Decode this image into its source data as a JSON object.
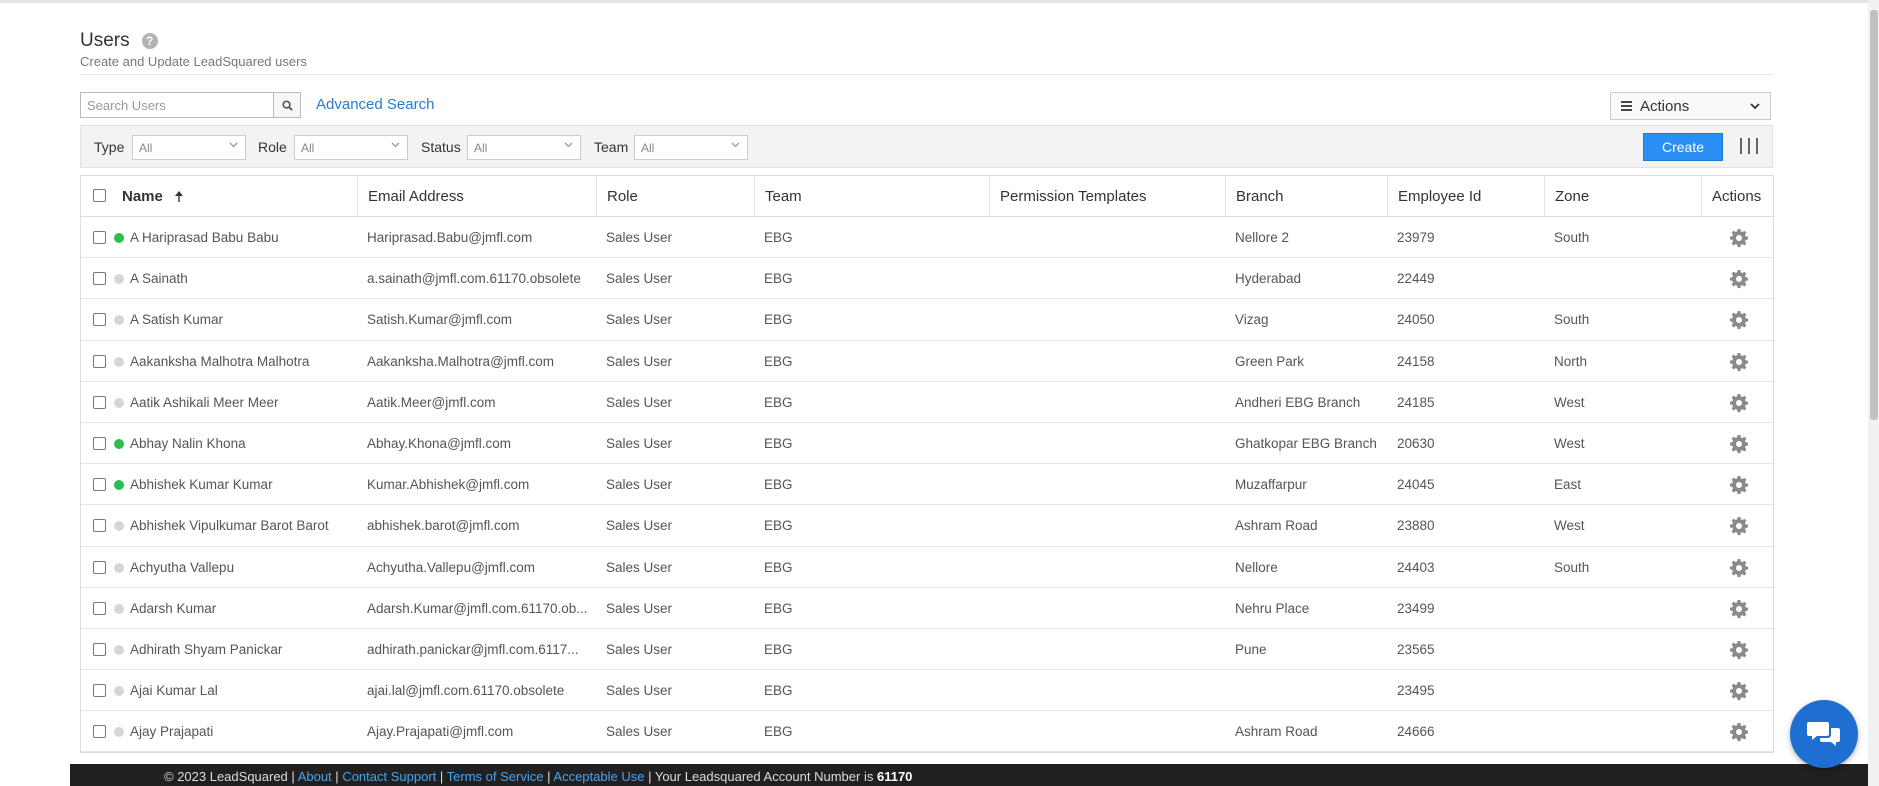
{
  "page": {
    "title": "Users",
    "subtitle": "Create and Update LeadSquared users"
  },
  "search": {
    "placeholder": "Search Users",
    "value": "",
    "advanced_label": "Advanced Search"
  },
  "actions_menu": {
    "label": "Actions"
  },
  "filters": [
    {
      "label": "Type",
      "value": "All"
    },
    {
      "label": "Role",
      "value": "All"
    },
    {
      "label": "Status",
      "value": "All"
    },
    {
      "label": "Team",
      "value": "All"
    }
  ],
  "create_label": "Create",
  "columns": [
    "Name",
    "Email Address",
    "Role",
    "Team",
    "Permission Templates",
    "Branch",
    "Employee Id",
    "Zone",
    "Actions"
  ],
  "status_colors": {
    "online": "#2dbd4e",
    "offline": "#d6d6d6"
  },
  "rows": [
    {
      "name": "A Hariprasad Babu Babu",
      "email": "Hariprasad.Babu@jmfl.com",
      "role": "Sales User",
      "team": "EBG",
      "permission": "",
      "branch": "Nellore 2",
      "employee_id": "23979",
      "zone": "South",
      "status": "online"
    },
    {
      "name": "A Sainath",
      "email": "a.sainath@jmfl.com.61170.obsolete",
      "role": "Sales User",
      "team": "EBG",
      "permission": "",
      "branch": "Hyderabad",
      "employee_id": "22449",
      "zone": "",
      "status": "offline"
    },
    {
      "name": "A Satish Kumar",
      "email": "Satish.Kumar@jmfl.com",
      "role": "Sales User",
      "team": "EBG",
      "permission": "",
      "branch": "Vizag",
      "employee_id": "24050",
      "zone": "South",
      "status": "offline"
    },
    {
      "name": "Aakanksha Malhotra Malhotra",
      "email": "Aakanksha.Malhotra@jmfl.com",
      "role": "Sales User",
      "team": "EBG",
      "permission": "",
      "branch": "Green Park",
      "employee_id": "24158",
      "zone": "North",
      "status": "offline"
    },
    {
      "name": "Aatik Ashikali Meer Meer",
      "email": "Aatik.Meer@jmfl.com",
      "role": "Sales User",
      "team": "EBG",
      "permission": "",
      "branch": "Andheri EBG Branch",
      "employee_id": "24185",
      "zone": "West",
      "status": "offline"
    },
    {
      "name": "Abhay Nalin Khona",
      "email": "Abhay.Khona@jmfl.com",
      "role": "Sales User",
      "team": "EBG",
      "permission": "",
      "branch": "Ghatkopar EBG Branch",
      "employee_id": "20630",
      "zone": "West",
      "status": "online"
    },
    {
      "name": "Abhishek Kumar Kumar",
      "email": "Kumar.Abhishek@jmfl.com",
      "role": "Sales User",
      "team": "EBG",
      "permission": "",
      "branch": "Muzaffarpur",
      "employee_id": "24045",
      "zone": "East",
      "status": "online"
    },
    {
      "name": "Abhishek Vipulkumar Barot Barot",
      "email": "abhishek.barot@jmfl.com",
      "role": "Sales User",
      "team": "EBG",
      "permission": "",
      "branch": "Ashram Road",
      "employee_id": "23880",
      "zone": "West",
      "status": "offline"
    },
    {
      "name": "Achyutha Vallepu",
      "email": "Achyutha.Vallepu@jmfl.com",
      "role": "Sales User",
      "team": "EBG",
      "permission": "",
      "branch": "Nellore",
      "employee_id": "24403",
      "zone": "South",
      "status": "offline"
    },
    {
      "name": "Adarsh Kumar",
      "email": "Adarsh.Kumar@jmfl.com.61170.ob...",
      "role": "Sales User",
      "team": "EBG",
      "permission": "",
      "branch": "Nehru Place",
      "employee_id": "23499",
      "zone": "",
      "status": "offline"
    },
    {
      "name": "Adhirath Shyam Panickar",
      "email": "adhirath.panickar@jmfl.com.6117...",
      "role": "Sales User",
      "team": "EBG",
      "permission": "",
      "branch": "Pune",
      "employee_id": "23565",
      "zone": "",
      "status": "offline"
    },
    {
      "name": "Ajai Kumar Lal",
      "email": "ajai.lal@jmfl.com.61170.obsolete",
      "role": "Sales User",
      "team": "EBG",
      "permission": "",
      "branch": "",
      "employee_id": "23495",
      "zone": "",
      "status": "offline"
    },
    {
      "name": "Ajay Prajapati",
      "email": "Ajay.Prajapati@jmfl.com",
      "role": "Sales User",
      "team": "EBG",
      "permission": "",
      "branch": "Ashram Road",
      "employee_id": "24666",
      "zone": "",
      "status": "offline"
    }
  ],
  "footer": {
    "copyright": "© 2023 LeadSquared |",
    "about": "About",
    "contact": "Contact Support",
    "terms": "Terms of Service",
    "acceptable": "Acceptable Use",
    "account_text": "| Your Leadsquared Account Number is",
    "account_number": "61170",
    "sep": "|"
  }
}
